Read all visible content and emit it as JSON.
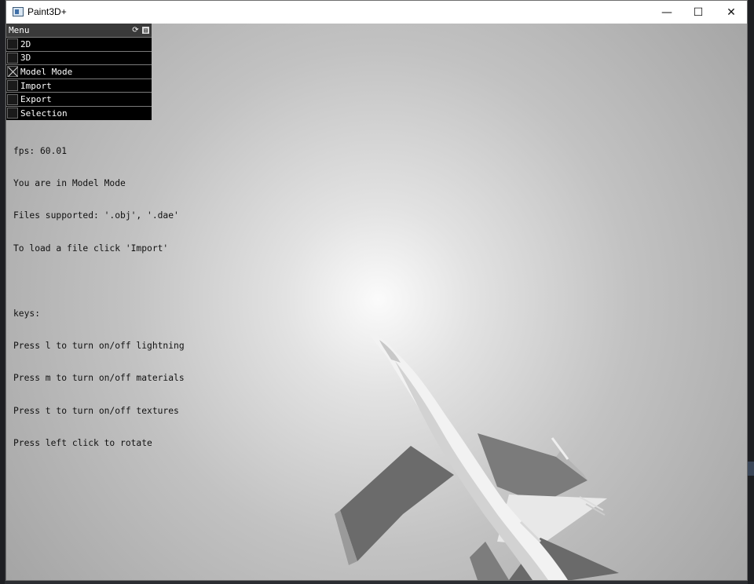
{
  "window": {
    "title": "Paint3D+",
    "minimize_icon": "minimize-icon",
    "maximize_icon": "maximize-icon",
    "close_icon": "close-icon"
  },
  "menu": {
    "header": "Menu",
    "header_icons": [
      "refresh-icon",
      "save-icon"
    ],
    "items": [
      {
        "label": "2D",
        "checked": false
      },
      {
        "label": "3D",
        "checked": false
      },
      {
        "label": "Model Mode",
        "checked": true
      },
      {
        "label": "Import",
        "checked": false
      },
      {
        "label": "Export",
        "checked": false
      },
      {
        "label": "Selection",
        "checked": false
      }
    ]
  },
  "info": {
    "fps": "fps: 60.01",
    "mode": "You are in Model Mode",
    "files": "Files supported: '.obj', '.dae'",
    "load": "To load a file click 'Import'",
    "keys_header": "keys:",
    "key_l": "Press l to turn on/off lightning",
    "key_m": "Press m to turn on/off materials",
    "key_t": "Press t to turn on/off textures",
    "key_click": "Press left click to rotate"
  },
  "colors": {
    "menu_bg": "#000000",
    "menu_header_bg": "#3a3a3a",
    "viewport_center": "#fbfbfb",
    "viewport_edge": "#949494"
  }
}
